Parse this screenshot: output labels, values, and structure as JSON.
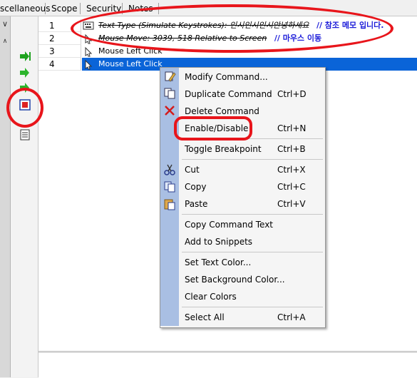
{
  "tabs": [
    {
      "label": "scellaneous"
    },
    {
      "label": "Scope"
    },
    {
      "label": "Security"
    },
    {
      "label": "Notes"
    }
  ],
  "left_panel": {
    "chevron": "∨",
    "up": "∧"
  },
  "rows": [
    {
      "num": "1",
      "text": "Text Type (Simulate Keystrokes): 인시인시인시안녕하세요",
      "comment": "// 참조 메모 입니다.",
      "icon": "keyboard-icon",
      "disabled": true
    },
    {
      "num": "2",
      "text": "Mouse Move: 3039, 518 Relative to Screen",
      "comment": "// 마우스 이동",
      "icon": "mouse-icon",
      "disabled": true
    },
    {
      "num": "3",
      "text": "Mouse Left Click",
      "icon": "mouse-icon",
      "disabled": false
    },
    {
      "num": "4",
      "text": "Mouse Left Click",
      "icon": "mouse-icon",
      "disabled": false,
      "selected": true
    }
  ],
  "context_menu": {
    "items": [
      {
        "label": "Modify Command...",
        "shortcut": "",
        "icon": "modify-icon"
      },
      {
        "label": "Duplicate Command",
        "shortcut": "Ctrl+D",
        "icon": "duplicate-icon"
      },
      {
        "label": "Delete Command",
        "shortcut": "",
        "icon": "delete-x-icon"
      },
      {
        "label": "Enable/Disable",
        "shortcut": "Ctrl+N",
        "icon": ""
      },
      {
        "label": "Toggle Breakpoint",
        "shortcut": "Ctrl+B",
        "icon": ""
      },
      {
        "label": "Cut",
        "shortcut": "Ctrl+X",
        "icon": "scissors-icon"
      },
      {
        "label": "Copy",
        "shortcut": "Ctrl+C",
        "icon": "copy-icon"
      },
      {
        "label": "Paste",
        "shortcut": "Ctrl+V",
        "icon": "paste-icon"
      },
      {
        "label": "Copy Command Text",
        "shortcut": "",
        "icon": ""
      },
      {
        "label": "Add to Snippets",
        "shortcut": "",
        "icon": ""
      },
      {
        "label": "Set Text Color...",
        "shortcut": "",
        "icon": ""
      },
      {
        "label": "Set Background Color...",
        "shortcut": "",
        "icon": ""
      },
      {
        "label": "Clear Colors",
        "shortcut": "",
        "icon": ""
      },
      {
        "label": "Select All",
        "shortcut": "Ctrl+A",
        "icon": ""
      }
    ]
  },
  "colors": {
    "selection": "#0a64d8",
    "annotation_red": "#e8151b",
    "comment_blue": "#1c1cd9",
    "menu_stripe": "#a9bfe3"
  }
}
